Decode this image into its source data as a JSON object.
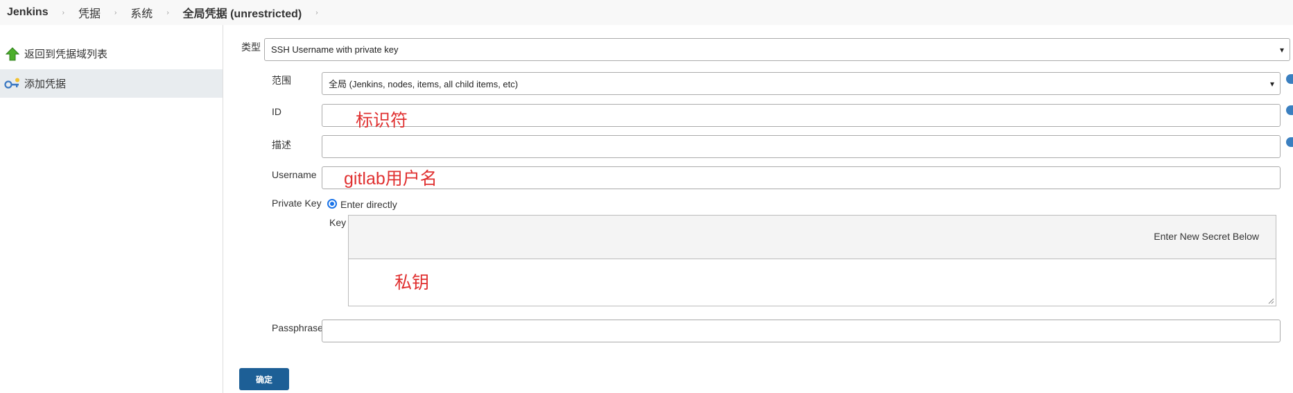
{
  "breadcrumb": {
    "items": [
      "Jenkins",
      "凭据",
      "系统",
      "全局凭据 (unrestricted)"
    ],
    "separator": "›"
  },
  "sidebar": {
    "items": [
      {
        "label": "返回到凭据域列表",
        "icon": "green-up-arrow-icon"
      },
      {
        "label": "添加凭据",
        "icon": "key-icon"
      }
    ]
  },
  "form": {
    "kind_label": "类型",
    "kind_value": "SSH Username with private key",
    "scope_label": "范围",
    "scope_value": "全局 (Jenkins, nodes, items, all child items, etc)",
    "id_label": "ID",
    "id_value": "",
    "description_label": "描述",
    "description_value": "",
    "username_label": "Username",
    "username_value": "",
    "private_key_label": "Private Key",
    "enter_directly_label": "Enter directly",
    "key_label": "Key",
    "key_header_text": "Enter New Secret Below",
    "passphrase_label": "Passphrase",
    "passphrase_value": "",
    "submit_label": "确定"
  },
  "annotations": {
    "id_note": "标识符",
    "username_note": "gitlab用户名",
    "key_note": "私钥",
    "color": "#e03030"
  },
  "colors": {
    "accent": "#1d5f96",
    "sidebar_active": "#e8ecef",
    "help": "#3a7fc0"
  }
}
